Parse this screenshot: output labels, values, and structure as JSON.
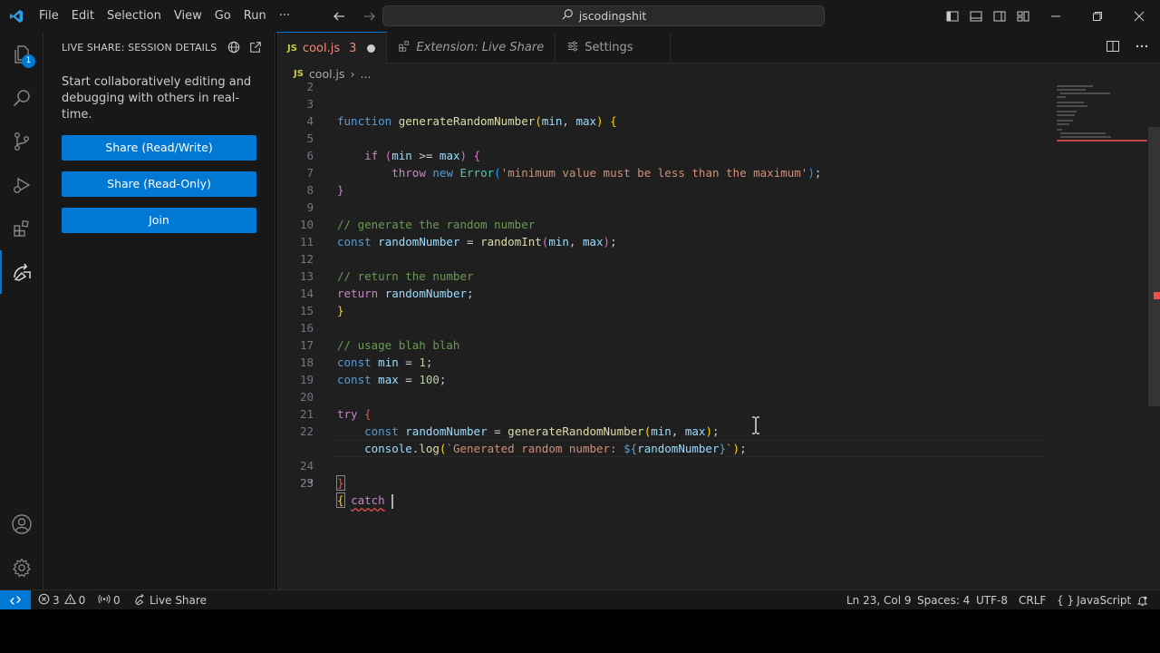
{
  "menu": [
    "File",
    "Edit",
    "Selection",
    "View",
    "Go",
    "Run",
    "···"
  ],
  "search": {
    "text": "jscodingshit"
  },
  "activity": {
    "explorer_badge": "1"
  },
  "sidebar": {
    "title": "LIVE SHARE: SESSION DETAILS",
    "description": "Start collaboratively editing and debugging with others in real-time.",
    "buttons": [
      "Share (Read/Write)",
      "Share (Read-Only)",
      "Join"
    ]
  },
  "tabs": [
    {
      "icon": "JS",
      "label": "cool.js",
      "errors": "3"
    },
    {
      "label": "Extension: Live Share"
    },
    {
      "label": "Settings"
    }
  ],
  "breadcrumb": {
    "icon": "JS",
    "file": "cool.js",
    "more": "..."
  },
  "editor": {
    "line_numbers": [
      "2",
      "3",
      "4",
      "5",
      "6",
      "7",
      "8",
      "9",
      "10",
      "11",
      "12",
      "13",
      "14",
      "15",
      "16",
      "17",
      "18",
      "19",
      "20",
      "21",
      "22",
      "23",
      "24",
      "25"
    ],
    "current_line": "23",
    "code": {
      "l3": {
        "kw": "function",
        "fn": "generateRandomNumber",
        "p1": "min",
        "p2": "max"
      },
      "l5": {
        "kw": "if",
        "a": "min",
        "op": " >= ",
        "b": "max"
      },
      "l6": {
        "kw1": "throw",
        "kw2": "new",
        "cls": "Error",
        "str": "'minimum value must be less than the maximum'"
      },
      "l9": "// generate the random number",
      "l10": {
        "kw": "const",
        "v": "randomNumber",
        "fn": "randomInt",
        "a": "min",
        "b": "max"
      },
      "l12": "// return the number",
      "l13": {
        "kw": "return",
        "v": "randomNumber"
      },
      "l16": "// usage blah blah",
      "l17": {
        "kw": "const",
        "v": "min",
        "n": "1"
      },
      "l18": {
        "kw": "const",
        "v": "max",
        "n": "100"
      },
      "l20": {
        "kw": "try"
      },
      "l21": {
        "kw": "const",
        "v": "randomNumber",
        "fn": "generateRandomNumber",
        "a": "min",
        "b": "max"
      },
      "l22": {
        "obj": "console",
        "fn": "log",
        "tpl": "`Generated random number: ",
        "interp": "randomNumber",
        "end": "`"
      },
      "l23": {
        "kw": "catch"
      }
    }
  },
  "status": {
    "errors": "3",
    "warnings": "0",
    "ports": "0",
    "live_share": "Live Share",
    "position": "Ln 23, Col 9",
    "spaces": "Spaces: 4",
    "encoding": "UTF-8",
    "eol": "CRLF",
    "language": "JavaScript"
  },
  "colors": {
    "accent": "#0078d4",
    "background": "#1f1f1f",
    "error": "#f14c4c"
  }
}
